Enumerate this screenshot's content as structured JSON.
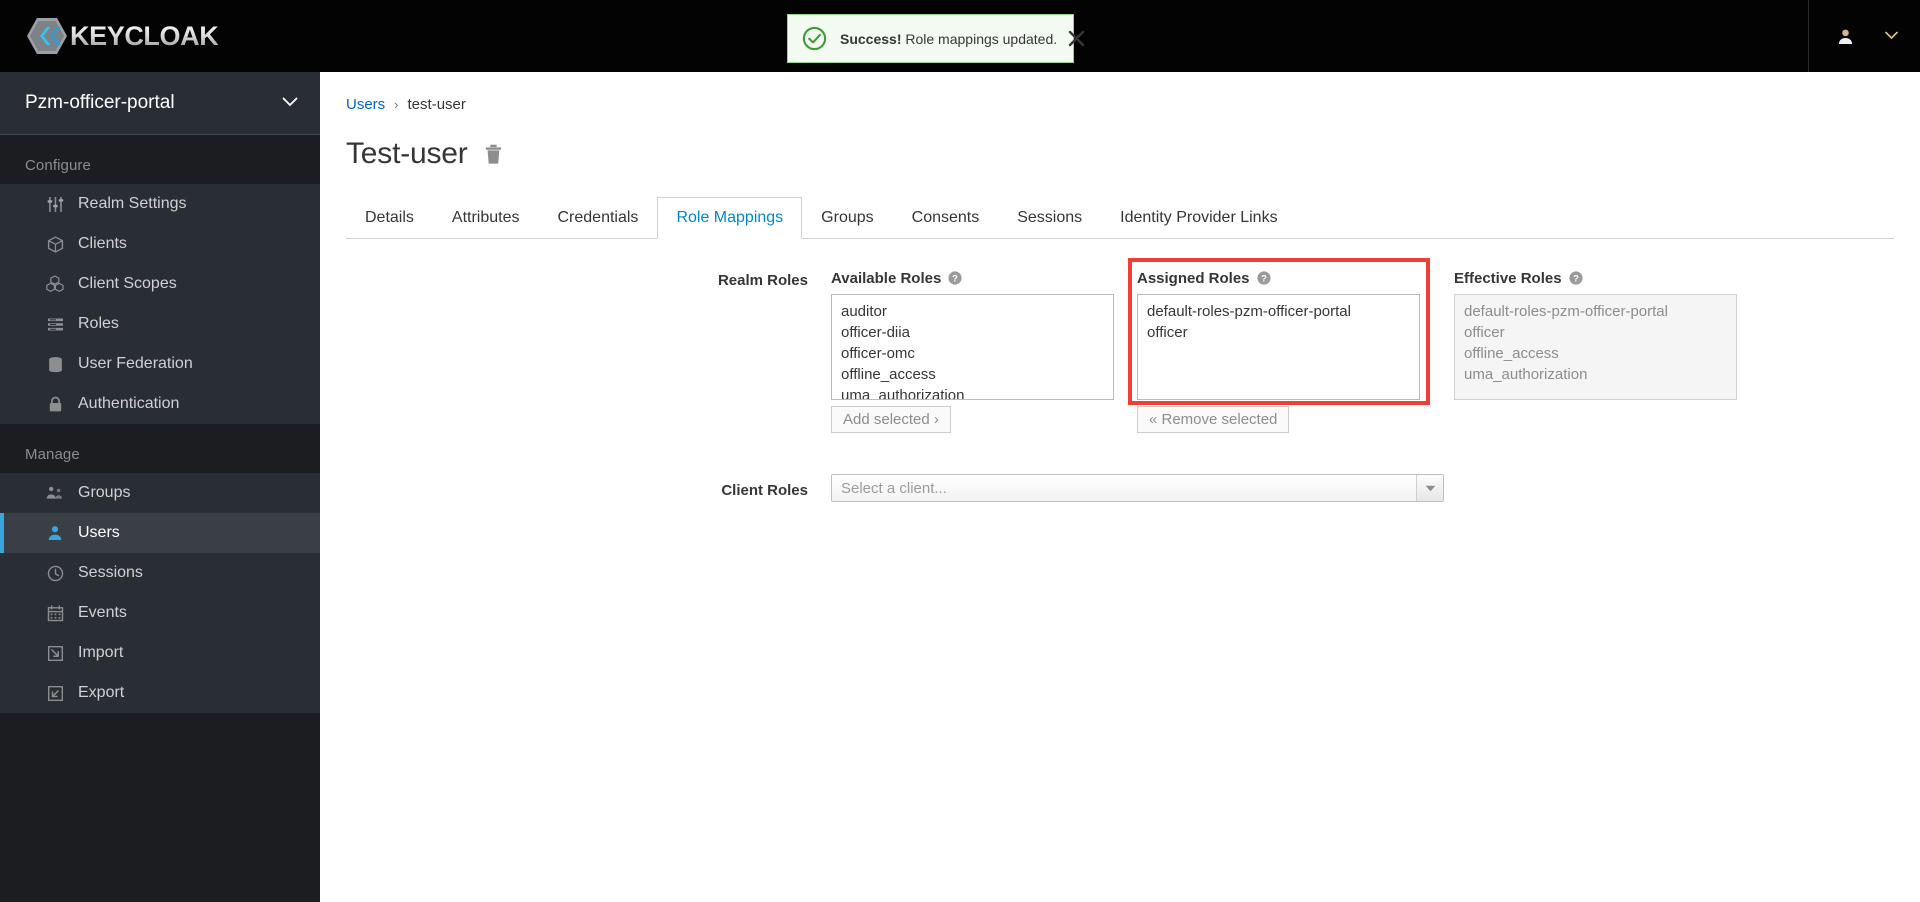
{
  "masthead": {
    "brand_text": "KEYCLOAK",
    "brand_logo_icon": "keycloak-hexagon-logo",
    "user_icon": "user-avatar-icon",
    "user_name": "",
    "caret_icon": "chevron-down-icon"
  },
  "alert": {
    "icon": "check-circle-icon",
    "strong": "Success!",
    "message": " Role mappings updated.",
    "close_icon": "close-icon",
    "bg_color": "#f3faf2",
    "border_color": "#96d38c",
    "accent_color": "#3f9c35"
  },
  "sidebar": {
    "realm": {
      "name": "Pzm-officer-portal",
      "caret_icon": "chevron-down-icon"
    },
    "sections": [
      {
        "title": "Configure",
        "items": [
          {
            "label": "Realm Settings",
            "icon": "sliders-icon",
            "active": false
          },
          {
            "label": "Clients",
            "icon": "cube-icon",
            "active": false
          },
          {
            "label": "Client Scopes",
            "icon": "cubes-icon",
            "active": false
          },
          {
            "label": "Roles",
            "icon": "list-rows-icon",
            "active": false
          },
          {
            "label": "User Federation",
            "icon": "database-icon",
            "active": false
          },
          {
            "label": "Authentication",
            "icon": "lock-icon",
            "active": false
          }
        ]
      },
      {
        "title": "Manage",
        "items": [
          {
            "label": "Groups",
            "icon": "users-group-icon",
            "active": false
          },
          {
            "label": "Users",
            "icon": "user-icon",
            "active": true
          },
          {
            "label": "Sessions",
            "icon": "clock-icon",
            "active": false
          },
          {
            "label": "Events",
            "icon": "calendar-icon",
            "active": false
          },
          {
            "label": "Import",
            "icon": "import-arrow-icon",
            "active": false
          },
          {
            "label": "Export",
            "icon": "export-arrow-icon",
            "active": false
          }
        ]
      }
    ],
    "active_accent_color": "#39a5dc"
  },
  "breadcrumb": {
    "root": "Users",
    "separator": "›",
    "current": "test-user"
  },
  "page": {
    "title": "Test-user",
    "delete_icon": "trash-icon"
  },
  "tabs": [
    {
      "label": "Details",
      "active": false
    },
    {
      "label": "Attributes",
      "active": false
    },
    {
      "label": "Credentials",
      "active": false
    },
    {
      "label": "Role Mappings",
      "active": true
    },
    {
      "label": "Groups",
      "active": false
    },
    {
      "label": "Consents",
      "active": false
    },
    {
      "label": "Sessions",
      "active": false
    },
    {
      "label": "Identity Provider Links",
      "active": false
    }
  ],
  "role_mappings": {
    "realm_roles_label": "Realm Roles",
    "available": {
      "heading": "Available Roles",
      "help_icon": "question-circle-icon",
      "options": [
        "auditor",
        "officer-diia",
        "officer-omc",
        "offline_access",
        "uma_authorization"
      ],
      "button_label": "Add selected ›"
    },
    "assigned": {
      "heading": "Assigned Roles",
      "help_icon": "question-circle-icon",
      "options": [
        "default-roles-pzm-officer-portal",
        "officer"
      ],
      "button_label": "« Remove selected",
      "highlighted": true,
      "highlight_color": "#ef3e36"
    },
    "effective": {
      "heading": "Effective Roles",
      "help_icon": "question-circle-icon",
      "options": [
        "default-roles-pzm-officer-portal",
        "officer",
        "offline_access",
        "uma_authorization"
      ],
      "disabled": true
    },
    "client_roles_label": "Client Roles",
    "client_select": {
      "placeholder": "Select a client...",
      "arrow_icon": "caret-down-icon"
    }
  }
}
